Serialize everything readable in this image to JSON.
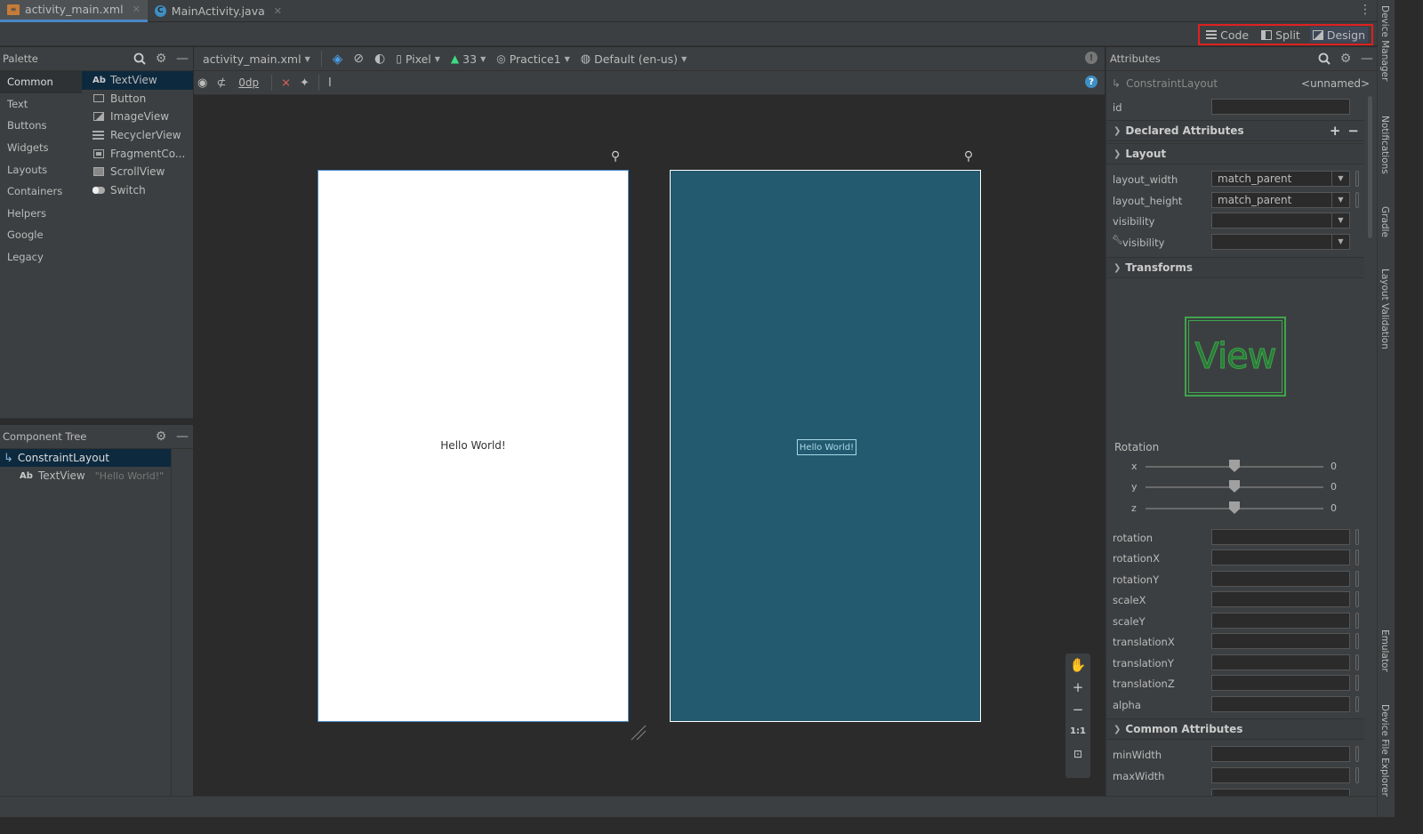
{
  "tabs": [
    {
      "label": "activity_main.xml",
      "icon": "xml-file-icon",
      "active": true
    },
    {
      "label": "MainActivity.java",
      "icon": "java-class-icon",
      "active": false
    }
  ],
  "view_modes": {
    "code": "Code",
    "split": "Split",
    "design": "Design"
  },
  "palette": {
    "title": "Palette",
    "categories": [
      "Common",
      "Text",
      "Buttons",
      "Widgets",
      "Layouts",
      "Containers",
      "Helpers",
      "Google",
      "Legacy"
    ],
    "items": [
      {
        "label": "TextView",
        "icon": "ab"
      },
      {
        "label": "Button",
        "icon": "button"
      },
      {
        "label": "ImageView",
        "icon": "image"
      },
      {
        "label": "RecyclerView",
        "icon": "list"
      },
      {
        "label": "FragmentCo...",
        "icon": "fragment"
      },
      {
        "label": "ScrollView",
        "icon": "scroll"
      },
      {
        "label": "Switch",
        "icon": "switch"
      }
    ]
  },
  "component_tree": {
    "title": "Component Tree",
    "nodes": [
      {
        "label": "ConstraintLayout",
        "hint": ""
      },
      {
        "label": "TextView",
        "hint": "\"Hello World!\""
      }
    ]
  },
  "design_toolbar": {
    "file": "activity_main.xml",
    "device": "Pixel",
    "api": "33",
    "theme": "Practice1",
    "locale": "Default (en-us)",
    "margin": "0dp"
  },
  "canvas": {
    "design_text": "Hello World!",
    "blueprint_text": "Hello World!",
    "zoom_fit": "1:1"
  },
  "attributes": {
    "title": "Attributes",
    "component": "ConstraintLayout",
    "component_name": "<unnamed>",
    "id_label": "id",
    "sections": {
      "declared": "Declared Attributes",
      "layout": "Layout",
      "transforms": "Transforms",
      "common": "Common Attributes"
    },
    "layout_rows": [
      {
        "label": "layout_width",
        "value": "match_parent"
      },
      {
        "label": "layout_height",
        "value": "match_parent"
      },
      {
        "label": "visibility",
        "value": ""
      },
      {
        "label": "visibility",
        "value": ""
      }
    ],
    "view_preview": "View",
    "rotation_label": "Rotation",
    "rotation": [
      {
        "axis": "x",
        "value": "0"
      },
      {
        "axis": "y",
        "value": "0"
      },
      {
        "axis": "z",
        "value": "0"
      }
    ],
    "transform_rows": [
      "rotation",
      "rotationX",
      "rotationY",
      "scaleX",
      "scaleY",
      "translationX",
      "translationY",
      "translationZ",
      "alpha"
    ],
    "common_rows": [
      "minWidth",
      "maxWidth"
    ]
  },
  "side_tabs": [
    "Device Manager",
    "Notifications",
    "Gradle",
    "Layout Validation",
    "Emulator",
    "Device File Explorer"
  ],
  "colors": {
    "accent": "#4a88c7",
    "blueprint": "#235a6f",
    "highlight": "#e02020",
    "view_green": "#3ea44b"
  }
}
